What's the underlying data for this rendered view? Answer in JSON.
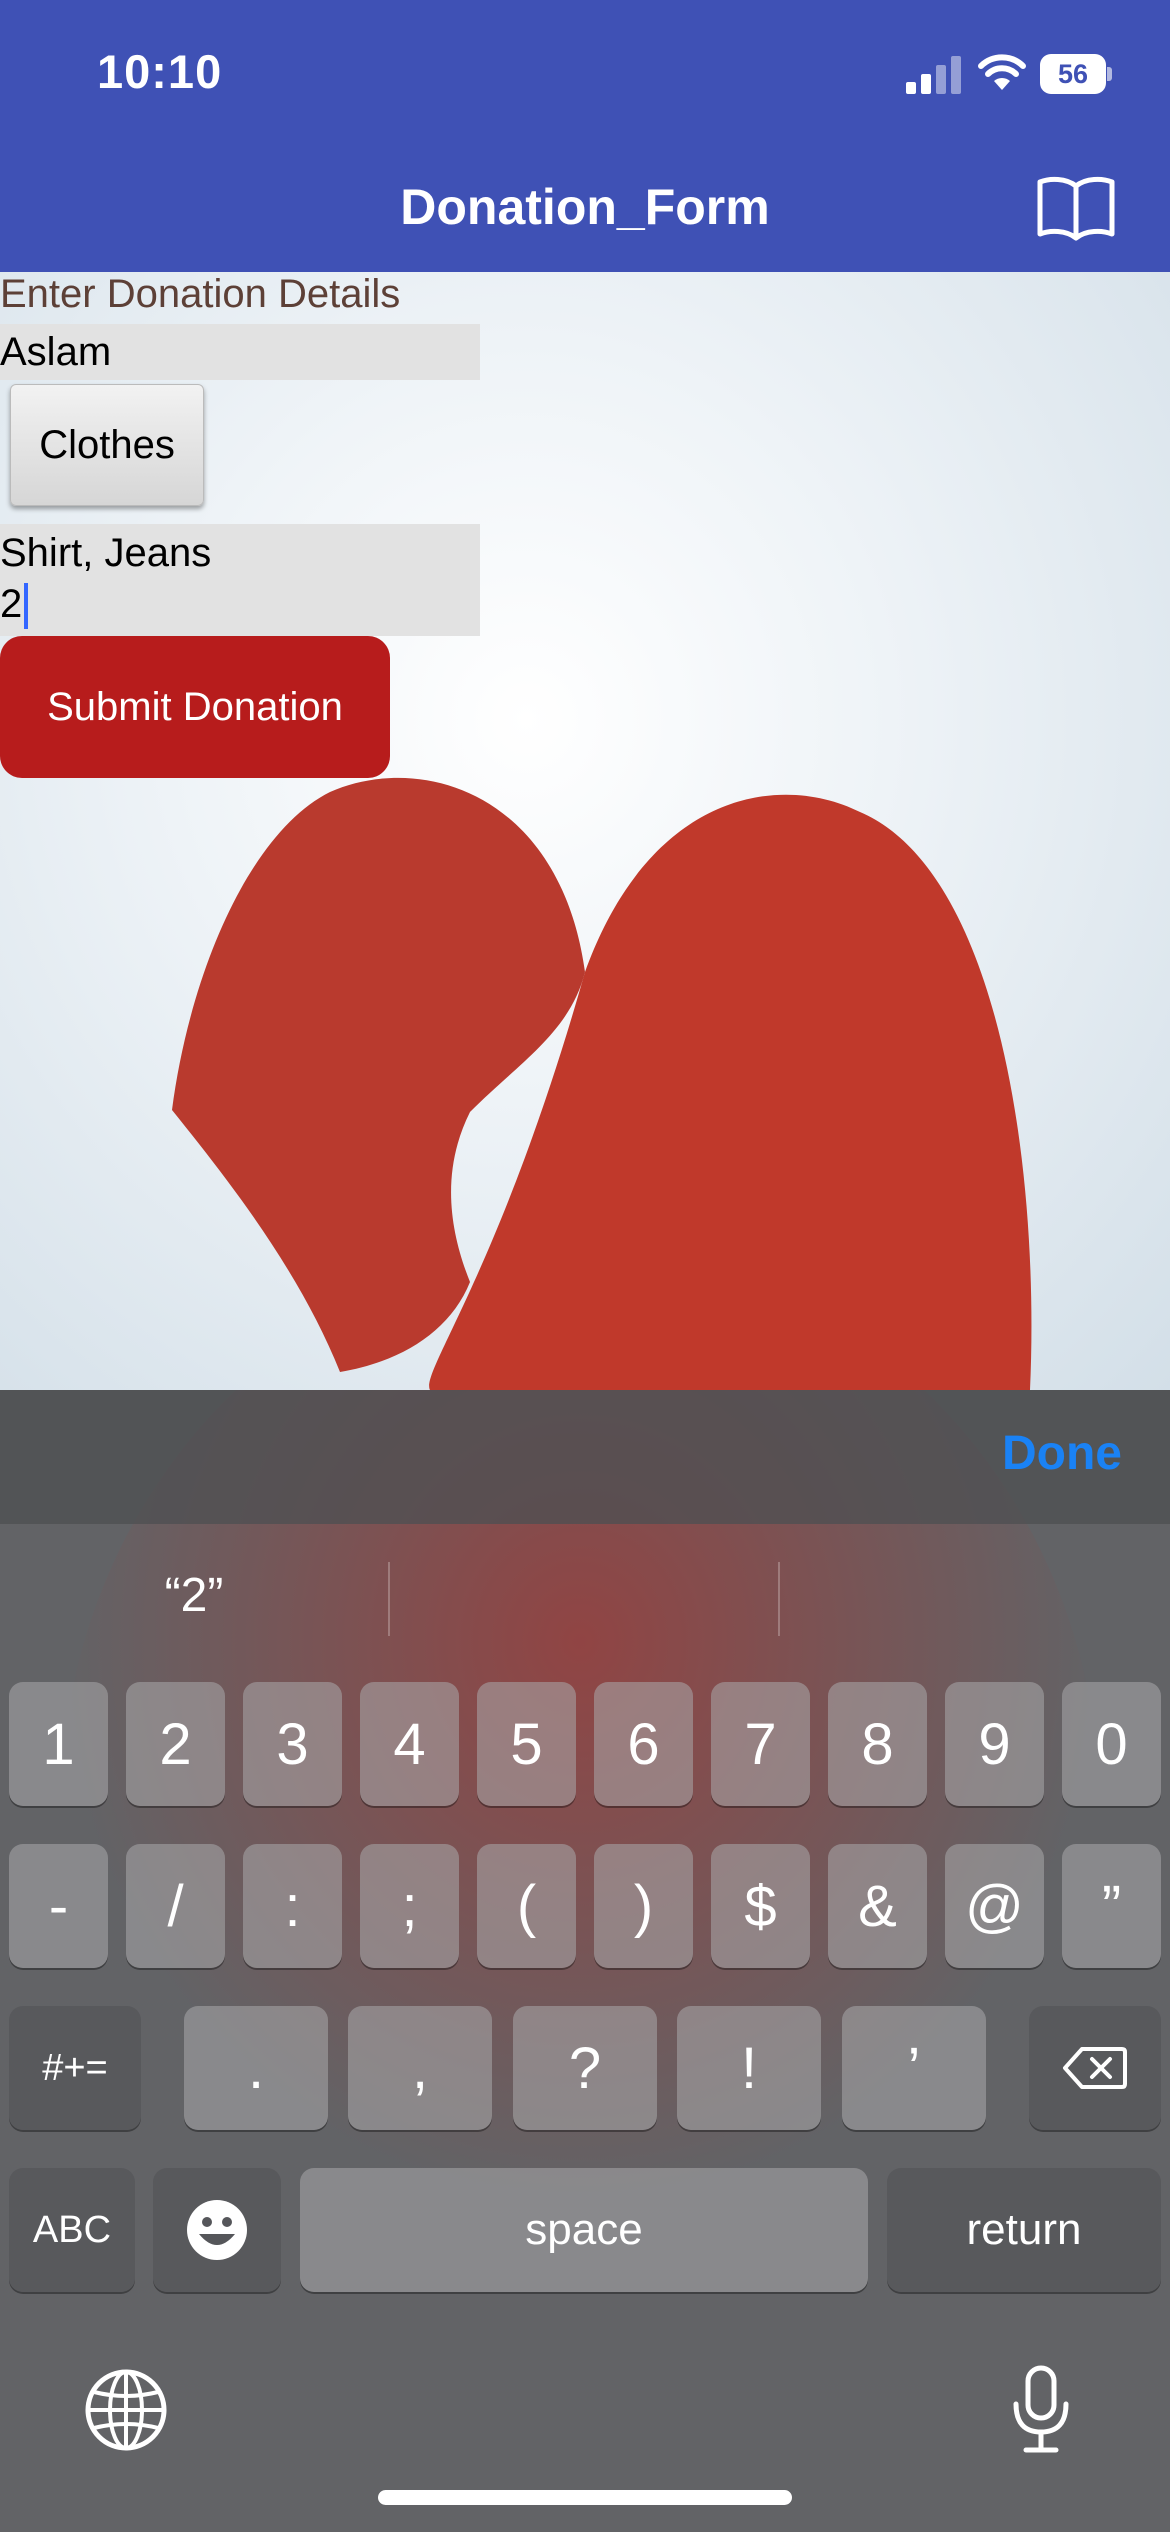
{
  "status_bar": {
    "time": "10:10",
    "battery": "56"
  },
  "nav": {
    "title": "Donation_Form",
    "book_icon": "book-icon"
  },
  "form": {
    "heading": "Enter Donation Details",
    "donor_name": "Aslam",
    "category_button": "Clothes",
    "items": "Shirt, Jeans",
    "quantity": "2",
    "submit_label": "Submit Donation"
  },
  "keyboard": {
    "done_label": "Done",
    "suggestions": [
      "“2”",
      "",
      ""
    ],
    "row1": [
      "1",
      "2",
      "3",
      "4",
      "5",
      "6",
      "7",
      "8",
      "9",
      "0"
    ],
    "row2": [
      "-",
      "/",
      ":",
      ";",
      "(",
      ")",
      "$",
      "&",
      "@",
      "”"
    ],
    "row3": {
      "toggle": "#+=",
      "keys": [
        ".",
        ",",
        "?",
        "!",
        "’"
      ]
    },
    "row4": {
      "abc": "ABC",
      "space": "space",
      "return": "return"
    }
  },
  "colors": {
    "nav": "#3f51b5",
    "submit": "#b71c1c",
    "done": "#1a82f5",
    "heading": "#5d4037"
  }
}
